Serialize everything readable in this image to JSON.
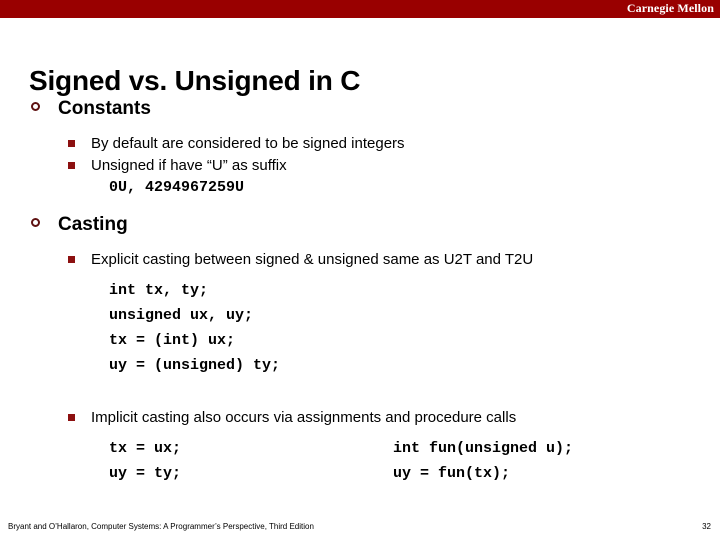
{
  "banner": {
    "institution": "Carnegie Mellon",
    "color": "#990000"
  },
  "slide": {
    "title": "Signed vs. Unsigned in C",
    "page_number": "32"
  },
  "markers": {
    "level1_color": "#5e1111",
    "level2_color": "#8c1010",
    "level1_icon": "hollow-circle-bullet-icon",
    "level2_icon": "filled-square-bullet-icon"
  },
  "sections": [
    {
      "heading": "Constants",
      "bullets": [
        "By default are considered to be signed integers",
        "Unsigned if have “U” as suffix"
      ],
      "code_lines": [
        "0U, 4294967259U"
      ]
    },
    {
      "heading": "Casting",
      "bullets": [
        "Explicit casting between signed & unsigned same as U2T and T2U"
      ],
      "code_lines": [
        "int tx, ty;",
        "unsigned ux, uy;",
        "tx = (int) ux;",
        "uy = (unsigned) ty;"
      ],
      "bullet2": "Implicit casting also occurs via assignments and procedure calls",
      "code_left": [
        "tx = ux;",
        "uy = ty;"
      ],
      "code_right": [
        "int fun(unsigned u);",
        "uy = fun(tx);"
      ]
    }
  ],
  "footer": {
    "citation": "Bryant and O’Hallaron, Computer Systems: A Programmer’s Perspective, Third Edition"
  }
}
